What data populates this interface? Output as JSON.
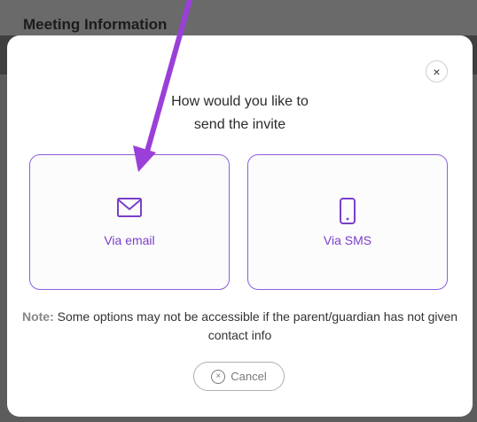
{
  "background": {
    "title": "Meeting Information"
  },
  "modal": {
    "close_icon": "×",
    "heading_line1": "How would you like to",
    "heading_line2": "send the invite",
    "options": [
      {
        "label": "Via email",
        "icon": "envelope-icon"
      },
      {
        "label": "Via SMS",
        "icon": "phone-icon"
      }
    ],
    "note_label": "Note:",
    "note_text": "Some options may not be accessible if the parent/guardian has not given contact info",
    "cancel_label": "Cancel",
    "cancel_icon": "×"
  },
  "colors": {
    "accent": "#7a3fc9",
    "option_border": "#8c5fdf",
    "annotation_arrow": "#9b3fd9"
  }
}
